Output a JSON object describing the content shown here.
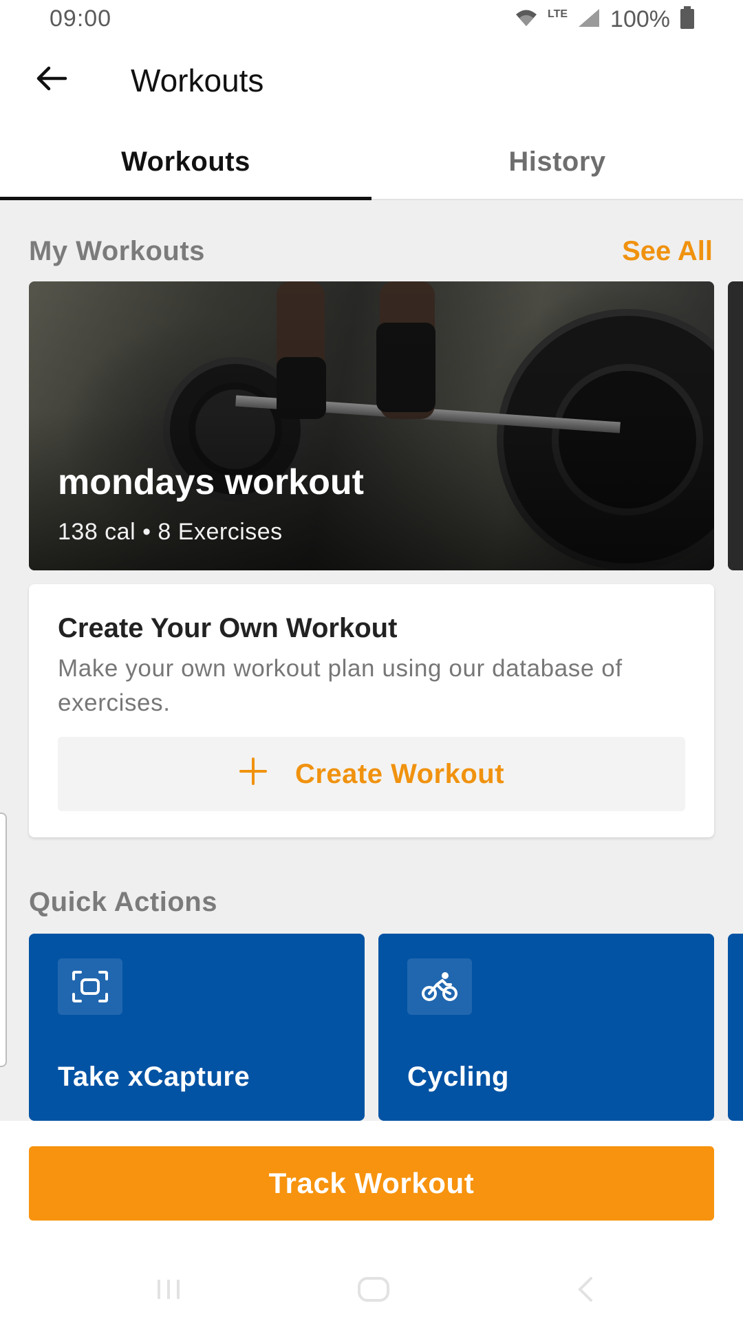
{
  "status_bar": {
    "time": "09:00",
    "network": "LTE",
    "battery": "100%"
  },
  "app_bar": {
    "title": "Workouts"
  },
  "tabs": [
    {
      "label": "Workouts",
      "active": true
    },
    {
      "label": "History",
      "active": false
    }
  ],
  "my_workouts": {
    "header": "My Workouts",
    "see_all": "See All",
    "card": {
      "title": "mondays workout",
      "subtitle": "138 cal • 8 Exercises"
    }
  },
  "create_card": {
    "title": "Create Your Own Workout",
    "description": "Make your own workout plan using our database of exercises.",
    "button_label": "Create Workout"
  },
  "quick_actions": {
    "header": "Quick Actions",
    "items": [
      {
        "label": "Take xCapture",
        "icon": "scan-frame-icon"
      },
      {
        "label": "Cycling",
        "icon": "cycling-icon"
      }
    ]
  },
  "track_button": "Track Workout",
  "colors": {
    "accent": "#F7930E",
    "quick_action_bg": "#0353A4",
    "content_bg": "#EFEFEF"
  }
}
